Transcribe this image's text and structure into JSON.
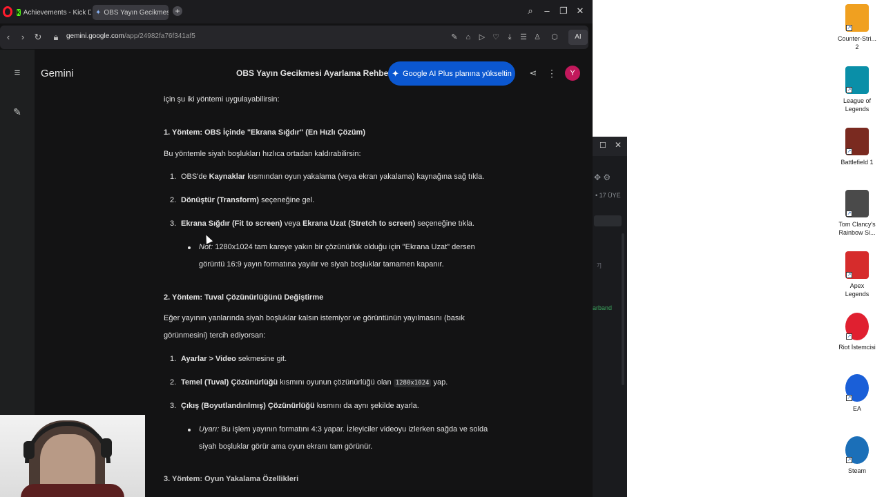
{
  "browser": {
    "tabs": [
      {
        "label": "Achievements - Kick Dash"
      },
      {
        "label": "OBS Yayın Gecikmesi Ayar"
      }
    ],
    "url_domain": "gemini.google.com",
    "url_path": "/app/24982fa76f341af5",
    "ai_label": "AI"
  },
  "gemini": {
    "app_name": "Gemini",
    "chat_title": "OBS Yayın Gecikmesi Ayarlama Rehberi",
    "upgrade_label": "Google AI Plus planına yükseltin",
    "avatar_letter": "Y"
  },
  "content": {
    "intro": "için şu iki yöntemi uygulayabilirsin:",
    "m1_title": "1. Yöntem: OBS İçinde \"Ekrana Sığdır\" (En Hızlı Çözüm)",
    "m1_desc": "Bu yöntemle siyah boşlukları hızlıca ortadan kaldırabilirsin:",
    "m1_items": [
      {
        "n": "1.",
        "pre": "OBS'de ",
        "b1": "Kaynaklar",
        "post": " kısmından oyun yakalama (veya ekran yakalama) kaynağına sağ tıkla."
      },
      {
        "n": "2.",
        "b1": "Dönüştür (Transform)",
        "post": " seçeneğine gel."
      },
      {
        "n": "3.",
        "b1": "Ekrana Sığdır (Fit to screen)",
        "mid": " veya ",
        "b2": "Ekrana Uzat (Stretch to screen)",
        "post": " seçeneğine tıkla."
      }
    ],
    "m1_note_label": "Not:",
    "m1_note_line1": " 1280x1024 tam kareye yakın bir çözünürlük olduğu için \"Ekrana Uzat\" dersen",
    "m1_note_line2": "görüntü 16:9 yayın formatına yayılır ve siyah boşluklar tamamen kapanır.",
    "m2_title": "2. Yöntem: Tuval Çözünürlüğünü Değiştirme",
    "m2_desc_line1": "Eğer yayının yanlarında siyah boşluklar kalsın istemiyor ve görüntünün yayılmasını (basık",
    "m2_desc_line2": "görünmesini) tercih ediyorsan:",
    "m2_items": [
      {
        "n": "1.",
        "b1": "Ayarlar > Video",
        "post": " sekmesine git."
      },
      {
        "n": "2.",
        "b1": "Temel (Tuval) Çözünürlüğü",
        "mid": " kısmını oyunun çözünürlüğü olan ",
        "code": "1280x1024",
        "post": " yap."
      },
      {
        "n": "3.",
        "b1": "Çıkış (Boyutlandırılmış) Çözünürlüğü",
        "post": " kısmını da aynı şekilde ayarla."
      }
    ],
    "m2_warn_label": "Uyarı:",
    "m2_warn_line1": " Bu işlem yayının formatını 4:3 yapar. İzleyiciler videoyu izlerken sağda ve solda",
    "m2_warn_line2": "siyah boşluklar görür ama oyun ekranı tam görünür.",
    "m3_title": "3. Yöntem: Oyun Yakalama Özellikleri"
  },
  "side_panel": {
    "members": "• 17 ÜYE",
    "bracket": "7]",
    "green_text": "arband"
  },
  "desktop": {
    "icons": [
      {
        "label1": "Counter-Stri...",
        "label2": "2",
        "color": "#f0a020"
      },
      {
        "label1": "League of",
        "label2": "Legends",
        "color": "#0a8fa8"
      },
      {
        "label1": "Battlefield 1",
        "label2": "",
        "color": "#7a2a20"
      },
      {
        "label1": "Tom Clancy's",
        "label2": "Rainbow Si...",
        "color": "#4a4a4a"
      },
      {
        "label1": "Apex",
        "label2": "Legends",
        "color": "#d62c2c"
      },
      {
        "label1": "Riot İstemcisi",
        "label2": "",
        "color": "#e02030"
      },
      {
        "label1": "EA",
        "label2": "",
        "color": "#1a5fd8"
      },
      {
        "label1": "Steam",
        "label2": "",
        "color": "#1b6fb8"
      }
    ]
  }
}
